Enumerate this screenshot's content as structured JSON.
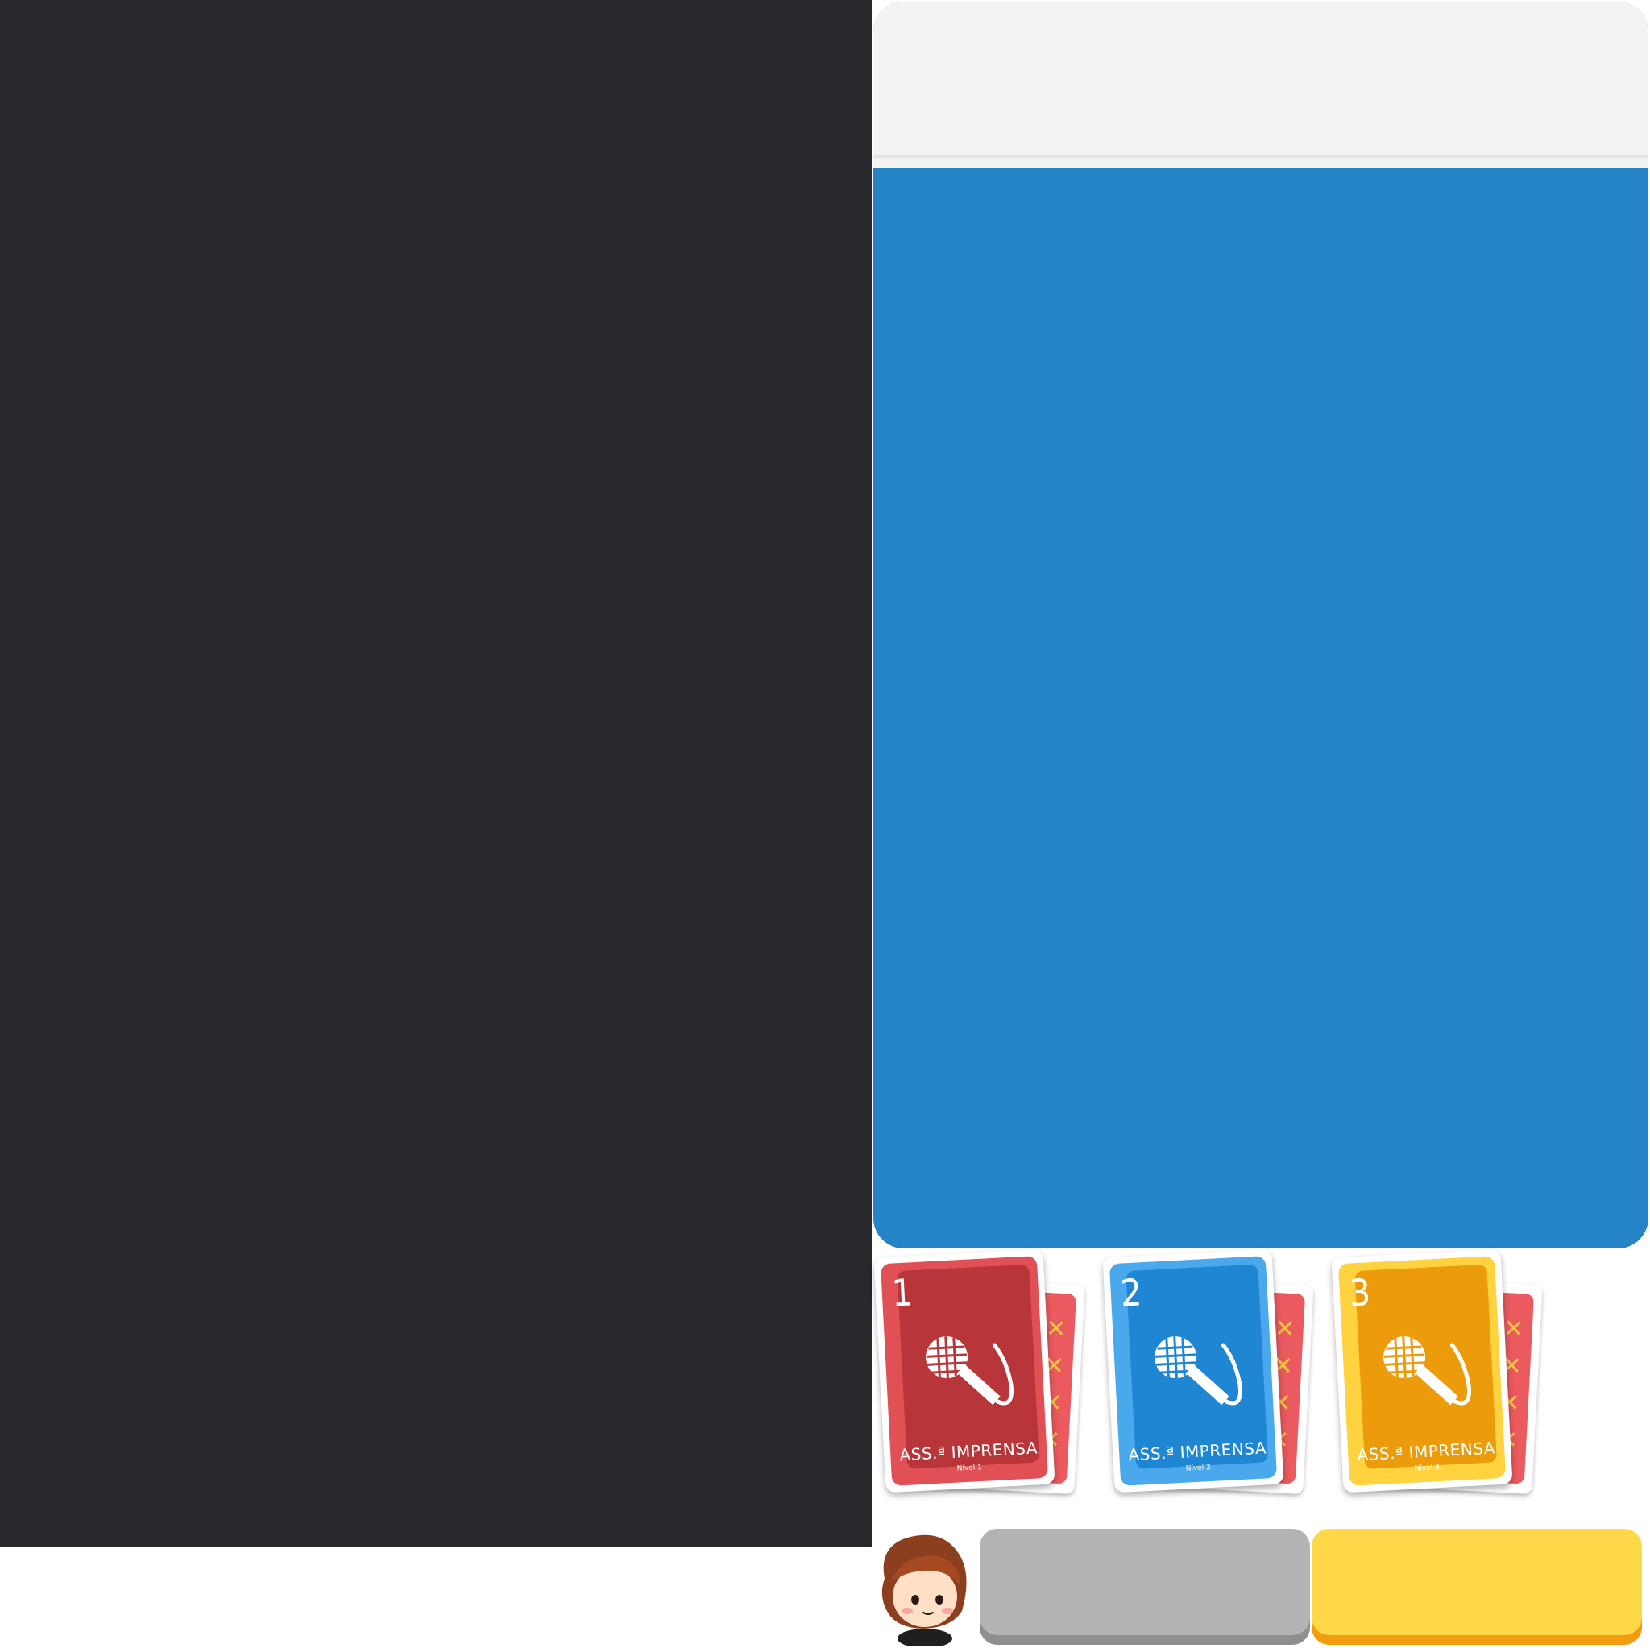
{
  "game": {
    "header_title": "",
    "board_color": "#2484c6",
    "header_color": "#f3f3f3",
    "sidebar_color": "#27282c"
  },
  "cards": [
    {
      "number": "1",
      "title": "ASS.ª IMPRENSA",
      "level": "Nível 1",
      "color": "#b8353a",
      "border_color": "#e15055",
      "icon": "microphone-icon"
    },
    {
      "number": "2",
      "title": "ASS.ª IMPRENSA",
      "level": "Nível 2",
      "color": "#1f86d4",
      "border_color": "#4aa9ec",
      "icon": "microphone-icon"
    },
    {
      "number": "3",
      "title": "ASS.ª IMPRENSA",
      "level": "Nível 3",
      "color": "#ec9c0a",
      "border_color": "#ffd23f",
      "icon": "microphone-icon"
    }
  ],
  "back_card": {
    "color": "#ea5a5e",
    "mark": "✕"
  },
  "actions": {
    "gray_button_label": "",
    "yellow_button_label": ""
  },
  "player": {
    "avatar": "player-avatar"
  }
}
